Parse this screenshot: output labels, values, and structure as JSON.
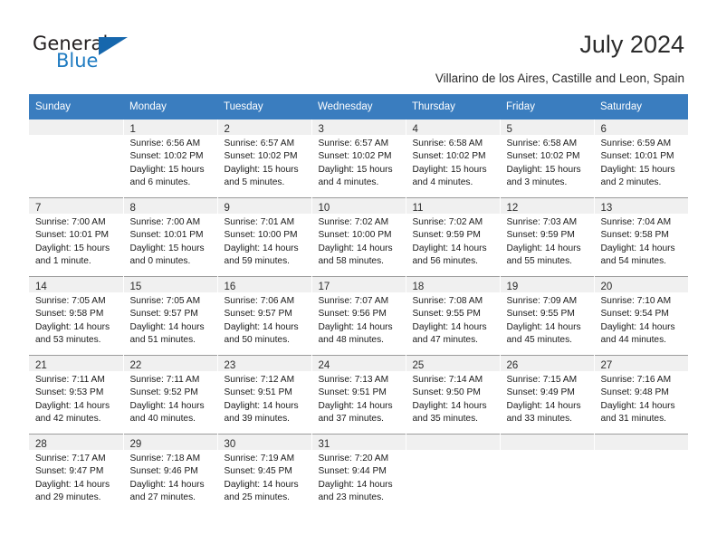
{
  "brand": {
    "name_part1": "General",
    "name_part2": "Blue",
    "triangle_color": "#1667ad",
    "blue_color": "#1f7bc1"
  },
  "header": {
    "title": "July 2024",
    "location": "Villarino de los Aires, Castille and Leon, Spain"
  },
  "calendar": {
    "header_bg": "#3a7dbf",
    "daynum_bg": "#f0f0f0",
    "weekdays": [
      "Sunday",
      "Monday",
      "Tuesday",
      "Wednesday",
      "Thursday",
      "Friday",
      "Saturday"
    ],
    "weeks": [
      [
        {
          "day": "",
          "lines": []
        },
        {
          "day": "1",
          "lines": [
            "Sunrise: 6:56 AM",
            "Sunset: 10:02 PM",
            "Daylight: 15 hours",
            "and 6 minutes."
          ]
        },
        {
          "day": "2",
          "lines": [
            "Sunrise: 6:57 AM",
            "Sunset: 10:02 PM",
            "Daylight: 15 hours",
            "and 5 minutes."
          ]
        },
        {
          "day": "3",
          "lines": [
            "Sunrise: 6:57 AM",
            "Sunset: 10:02 PM",
            "Daylight: 15 hours",
            "and 4 minutes."
          ]
        },
        {
          "day": "4",
          "lines": [
            "Sunrise: 6:58 AM",
            "Sunset: 10:02 PM",
            "Daylight: 15 hours",
            "and 4 minutes."
          ]
        },
        {
          "day": "5",
          "lines": [
            "Sunrise: 6:58 AM",
            "Sunset: 10:02 PM",
            "Daylight: 15 hours",
            "and 3 minutes."
          ]
        },
        {
          "day": "6",
          "lines": [
            "Sunrise: 6:59 AM",
            "Sunset: 10:01 PM",
            "Daylight: 15 hours",
            "and 2 minutes."
          ]
        }
      ],
      [
        {
          "day": "7",
          "lines": [
            "Sunrise: 7:00 AM",
            "Sunset: 10:01 PM",
            "Daylight: 15 hours",
            "and 1 minute."
          ]
        },
        {
          "day": "8",
          "lines": [
            "Sunrise: 7:00 AM",
            "Sunset: 10:01 PM",
            "Daylight: 15 hours",
            "and 0 minutes."
          ]
        },
        {
          "day": "9",
          "lines": [
            "Sunrise: 7:01 AM",
            "Sunset: 10:00 PM",
            "Daylight: 14 hours",
            "and 59 minutes."
          ]
        },
        {
          "day": "10",
          "lines": [
            "Sunrise: 7:02 AM",
            "Sunset: 10:00 PM",
            "Daylight: 14 hours",
            "and 58 minutes."
          ]
        },
        {
          "day": "11",
          "lines": [
            "Sunrise: 7:02 AM",
            "Sunset: 9:59 PM",
            "Daylight: 14 hours",
            "and 56 minutes."
          ]
        },
        {
          "day": "12",
          "lines": [
            "Sunrise: 7:03 AM",
            "Sunset: 9:59 PM",
            "Daylight: 14 hours",
            "and 55 minutes."
          ]
        },
        {
          "day": "13",
          "lines": [
            "Sunrise: 7:04 AM",
            "Sunset: 9:58 PM",
            "Daylight: 14 hours",
            "and 54 minutes."
          ]
        }
      ],
      [
        {
          "day": "14",
          "lines": [
            "Sunrise: 7:05 AM",
            "Sunset: 9:58 PM",
            "Daylight: 14 hours",
            "and 53 minutes."
          ]
        },
        {
          "day": "15",
          "lines": [
            "Sunrise: 7:05 AM",
            "Sunset: 9:57 PM",
            "Daylight: 14 hours",
            "and 51 minutes."
          ]
        },
        {
          "day": "16",
          "lines": [
            "Sunrise: 7:06 AM",
            "Sunset: 9:57 PM",
            "Daylight: 14 hours",
            "and 50 minutes."
          ]
        },
        {
          "day": "17",
          "lines": [
            "Sunrise: 7:07 AM",
            "Sunset: 9:56 PM",
            "Daylight: 14 hours",
            "and 48 minutes."
          ]
        },
        {
          "day": "18",
          "lines": [
            "Sunrise: 7:08 AM",
            "Sunset: 9:55 PM",
            "Daylight: 14 hours",
            "and 47 minutes."
          ]
        },
        {
          "day": "19",
          "lines": [
            "Sunrise: 7:09 AM",
            "Sunset: 9:55 PM",
            "Daylight: 14 hours",
            "and 45 minutes."
          ]
        },
        {
          "day": "20",
          "lines": [
            "Sunrise: 7:10 AM",
            "Sunset: 9:54 PM",
            "Daylight: 14 hours",
            "and 44 minutes."
          ]
        }
      ],
      [
        {
          "day": "21",
          "lines": [
            "Sunrise: 7:11 AM",
            "Sunset: 9:53 PM",
            "Daylight: 14 hours",
            "and 42 minutes."
          ]
        },
        {
          "day": "22",
          "lines": [
            "Sunrise: 7:11 AM",
            "Sunset: 9:52 PM",
            "Daylight: 14 hours",
            "and 40 minutes."
          ]
        },
        {
          "day": "23",
          "lines": [
            "Sunrise: 7:12 AM",
            "Sunset: 9:51 PM",
            "Daylight: 14 hours",
            "and 39 minutes."
          ]
        },
        {
          "day": "24",
          "lines": [
            "Sunrise: 7:13 AM",
            "Sunset: 9:51 PM",
            "Daylight: 14 hours",
            "and 37 minutes."
          ]
        },
        {
          "day": "25",
          "lines": [
            "Sunrise: 7:14 AM",
            "Sunset: 9:50 PM",
            "Daylight: 14 hours",
            "and 35 minutes."
          ]
        },
        {
          "day": "26",
          "lines": [
            "Sunrise: 7:15 AM",
            "Sunset: 9:49 PM",
            "Daylight: 14 hours",
            "and 33 minutes."
          ]
        },
        {
          "day": "27",
          "lines": [
            "Sunrise: 7:16 AM",
            "Sunset: 9:48 PM",
            "Daylight: 14 hours",
            "and 31 minutes."
          ]
        }
      ],
      [
        {
          "day": "28",
          "lines": [
            "Sunrise: 7:17 AM",
            "Sunset: 9:47 PM",
            "Daylight: 14 hours",
            "and 29 minutes."
          ]
        },
        {
          "day": "29",
          "lines": [
            "Sunrise: 7:18 AM",
            "Sunset: 9:46 PM",
            "Daylight: 14 hours",
            "and 27 minutes."
          ]
        },
        {
          "day": "30",
          "lines": [
            "Sunrise: 7:19 AM",
            "Sunset: 9:45 PM",
            "Daylight: 14 hours",
            "and 25 minutes."
          ]
        },
        {
          "day": "31",
          "lines": [
            "Sunrise: 7:20 AM",
            "Sunset: 9:44 PM",
            "Daylight: 14 hours",
            "and 23 minutes."
          ]
        },
        {
          "day": "",
          "lines": []
        },
        {
          "day": "",
          "lines": []
        },
        {
          "day": "",
          "lines": []
        }
      ]
    ]
  }
}
